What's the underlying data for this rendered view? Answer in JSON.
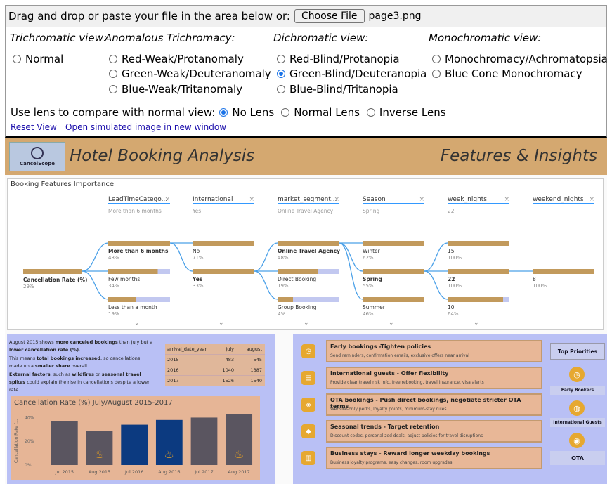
{
  "topbar": {
    "prompt": "Drag and drop or paste your file in the area below or:",
    "choose_label": "Choose File",
    "file_name": "page3.png"
  },
  "headers": {
    "trichromatic": "Trichromatic view:",
    "anomalous": "Anomalous Trichromacy:",
    "dichromatic": "Dichromatic view:",
    "monochromatic": "Monochromatic view:"
  },
  "options": {
    "normal": "Normal",
    "protanomaly": "Red-Weak/Protanomaly",
    "deuteranomaly": "Green-Weak/Deuteranomaly",
    "tritanomaly": "Blue-Weak/Tritanomaly",
    "protanopia": "Red-Blind/Protanopia",
    "deuteranopia": "Green-Blind/Deuteranopia",
    "tritanopia": "Blue-Blind/Tritanopia",
    "achromatopsia": "Monochromacy/Achromatopsia",
    "blue_cone": "Blue Cone Monochromacy",
    "selected": "deuteranopia"
  },
  "lens": {
    "label": "Use lens to compare with normal view:",
    "no_lens": "No Lens",
    "normal_lens": "Normal Lens",
    "inverse_lens": "Inverse Lens",
    "selected": "no_lens"
  },
  "links": {
    "reset": "Reset View",
    "open_new": "Open simulated image in new window"
  },
  "report": {
    "logo_text": "CancelScope",
    "title": "Hotel Booking Analysis",
    "subtitle": "Features & Insights",
    "ki_title": "Booking Features Importance",
    "dims": [
      {
        "name": "LeadTimeCatego...",
        "value": "More than 6 months"
      },
      {
        "name": "International",
        "value": "Yes"
      },
      {
        "name": "market_segment...",
        "value": "Online Travel Agency"
      },
      {
        "name": "Season",
        "value": "Spring"
      },
      {
        "name": "week_nights",
        "value": "22"
      },
      {
        "name": "weekend_nights",
        "value": ""
      }
    ],
    "root": {
      "label": "Cancellation Rate (%)",
      "pct": "29%"
    },
    "nodes": [
      {
        "col": 0,
        "row": 0,
        "label": "More than 6 months",
        "pct": "43%",
        "bold": true,
        "fill": 1.0
      },
      {
        "col": 0,
        "row": 1,
        "label": "Few months",
        "pct": "34%",
        "bold": false,
        "fill": 0.8
      },
      {
        "col": 0,
        "row": 2,
        "label": "Less than a month",
        "pct": "19%",
        "bold": false,
        "fill": 0.45
      },
      {
        "col": 1,
        "row": 0,
        "label": "No",
        "pct": "71%",
        "bold": false,
        "fill": 1.0
      },
      {
        "col": 1,
        "row": 1,
        "label": "Yes",
        "pct": "33%",
        "bold": true,
        "fill": 1.0
      },
      {
        "col": 2,
        "row": 0,
        "label": "Online Travel Agency",
        "pct": "48%",
        "bold": true,
        "fill": 1.0
      },
      {
        "col": 2,
        "row": 1,
        "label": "Direct Booking",
        "pct": "19%",
        "bold": false,
        "fill": 0.65
      },
      {
        "col": 2,
        "row": 2,
        "label": "Group Booking",
        "pct": "4%",
        "bold": false,
        "fill": 0.25
      },
      {
        "col": 3,
        "row": 0,
        "label": "Winter",
        "pct": "62%",
        "bold": false,
        "fill": 1.0
      },
      {
        "col": 3,
        "row": 1,
        "label": "Spring",
        "pct": "55%",
        "bold": true,
        "fill": 1.0
      },
      {
        "col": 3,
        "row": 2,
        "label": "Summer",
        "pct": "46%",
        "bold": false,
        "fill": 1.0
      },
      {
        "col": 4,
        "row": 0,
        "label": "15",
        "pct": "100%",
        "bold": false,
        "fill": 1.0
      },
      {
        "col": 4,
        "row": 1,
        "label": "22",
        "pct": "100%",
        "bold": true,
        "fill": 1.0
      },
      {
        "col": 4,
        "row": 2,
        "label": "10",
        "pct": "64%",
        "bold": false,
        "fill": 0.9
      },
      {
        "col": 5,
        "row": 1,
        "label": "8",
        "pct": "100%",
        "bold": false,
        "fill": 1.0
      }
    ],
    "notes": [
      [
        {
          "t": "August 2015 shows "
        },
        {
          "t": "more canceled bookings",
          "b": true
        },
        {
          "t": " than July but a "
        },
        {
          "t": "lower cancellation rate (%).",
          "b": true
        }
      ],
      [
        {
          "t": "This means "
        },
        {
          "t": "total bookings increased",
          "b": true
        },
        {
          "t": ", so cancellations made up a "
        },
        {
          "t": "smaller share",
          "b": true
        },
        {
          "t": " overall."
        }
      ],
      [
        {
          "t": "External factors",
          "b": true
        },
        {
          "t": ", such as "
        },
        {
          "t": "wildfires",
          "b": true
        },
        {
          "t": " or "
        },
        {
          "t": "seasonal travel spikes",
          "b": true
        },
        {
          "t": " could explain the rise in cancellations despite a lower rate."
        }
      ]
    ],
    "table": {
      "headers": [
        "arrival_date_year",
        "july",
        "august"
      ],
      "rows": [
        [
          "2015",
          "483",
          "545"
        ],
        [
          "2016",
          "1040",
          "1387"
        ],
        [
          "2017",
          "1526",
          "1540"
        ]
      ]
    },
    "insights": [
      {
        "title": "Early bookings -Tighten policies",
        "desc": "Send reminders, confirmation emails, exclusive offers near arrival"
      },
      {
        "title": "International guests - Offer flexibility",
        "desc": "Provide clear travel risk info, free rebooking, travel insurance, visa alerts"
      },
      {
        "title": "OTA bookings - Push direct bookings, negotiate stricter OTA terms",
        "desc": "Website-only perks, loyalty points, minimum-stay rules"
      },
      {
        "title": "Seasonal trends - Target retention",
        "desc": "Discount codes, personalized deals, adjust policies for travel disruptions"
      },
      {
        "title": "Business stays - Reward longer weekday bookings",
        "desc": "Business loyalty programs, easy changes, room upgrades"
      }
    ],
    "priorities": {
      "title": "Top Priorities",
      "items": [
        "Early Bookers",
        "International Guests",
        "OTA"
      ]
    }
  },
  "chart_data": {
    "type": "bar",
    "title": "Cancellation Rate (%) July/August 2015-2017",
    "ylabel": "Cancellation Rate (...",
    "categories": [
      "Jul 2015",
      "Aug 2015",
      "Jul 2016",
      "Aug 2016",
      "Jul 2017",
      "Aug 2017"
    ],
    "values": [
      37,
      29,
      34,
      38,
      40,
      43
    ],
    "highlighted": [
      false,
      true,
      false,
      true,
      false,
      true
    ],
    "ylim": [
      0,
      45
    ],
    "yticks": [
      "0%",
      "20%",
      "40%"
    ],
    "colors": {
      "bar": "#5a5560",
      "bar_alt": "#0c3a80"
    }
  }
}
